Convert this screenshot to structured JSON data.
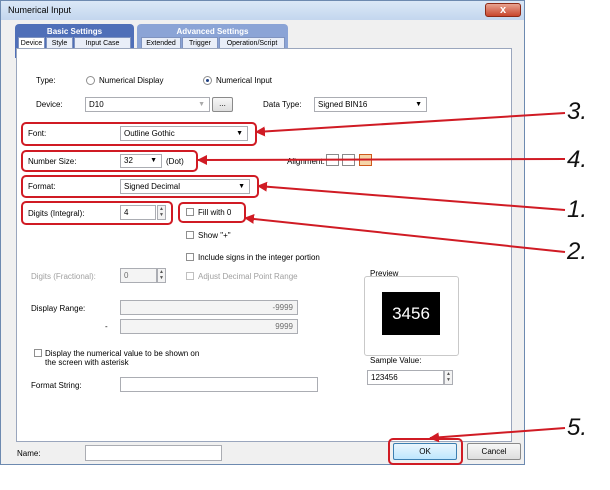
{
  "window": {
    "title": "Numerical Input",
    "close": "x"
  },
  "tab_groups": {
    "basic": "Basic Settings",
    "advanced": "Advanced Settings"
  },
  "tabs": [
    "Device",
    "Style",
    "Input Case",
    "Extended",
    "Trigger",
    "Operation/Script"
  ],
  "type": {
    "label": "Type:",
    "option1": "Numerical Display",
    "option2": "Numerical Input",
    "selected": "Numerical Input"
  },
  "device": {
    "label": "Device:",
    "value": "D10",
    "browse": "..."
  },
  "data_type": {
    "label": "Data Type:",
    "value": "Signed BIN16"
  },
  "font": {
    "label": "Font:",
    "value": "Outline Gothic"
  },
  "number_size": {
    "label": "Number Size:",
    "value": "32",
    "unit": "(Dot)"
  },
  "alignment": {
    "label": "Alignment:"
  },
  "format": {
    "label": "Format:",
    "value": "Signed Decimal"
  },
  "digits_integral": {
    "label": "Digits (Integral):",
    "value": "4"
  },
  "fill_with_zero": {
    "label": "Fill with 0",
    "checked": false
  },
  "show_plus": {
    "label": "Show \"+\"",
    "checked": false
  },
  "include_signs": {
    "label": "Include signs in the integer portion",
    "checked": false
  },
  "digits_fractional": {
    "label": "Digits (Fractional):",
    "value": "0"
  },
  "adjust_decimal": {
    "label": "Adjust Decimal Point Range",
    "checked": false
  },
  "display_range": {
    "label": "Display Range:",
    "max": "-9999",
    "separator": "-",
    "min": "9999"
  },
  "asterisk": {
    "line1": "Display the numerical value to be shown on",
    "line2": "the screen with asterisk",
    "checked": false
  },
  "format_string": {
    "label": "Format String:",
    "value": ""
  },
  "preview": {
    "label": "Preview",
    "value": "3456"
  },
  "sample_value": {
    "label": "Sample Value:",
    "value": "123456"
  },
  "name": {
    "label": "Name:",
    "value": ""
  },
  "buttons": {
    "ok": "OK",
    "cancel": "Cancel"
  },
  "callouts": [
    "3.",
    "4.",
    "1.",
    "2.",
    "5."
  ],
  "colors": {
    "callout_red": "#d01b24",
    "tab_basic": "#4f6fb8",
    "tab_advanced": "#8ba4d6"
  }
}
